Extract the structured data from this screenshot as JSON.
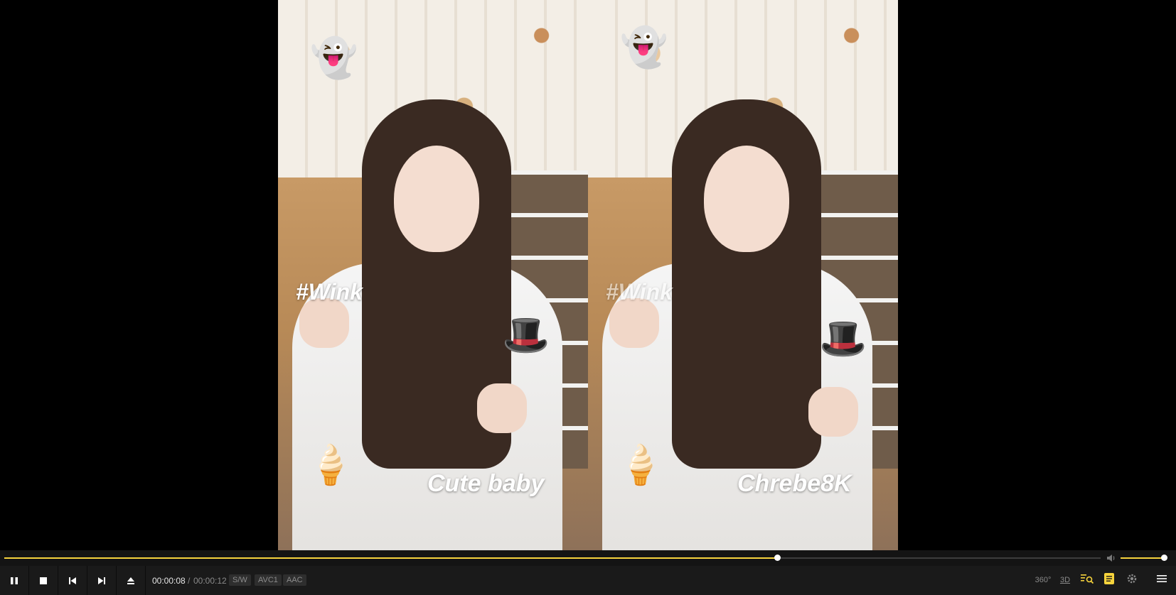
{
  "video": {
    "left_caption_tag": "#Wink",
    "left_caption_main": "Cute baby",
    "right_caption_tag": "#Wink",
    "right_caption_main": "Chrebe8K"
  },
  "playback": {
    "current_time": "00:00:08",
    "separator": "/",
    "total_time": "00:00:12",
    "progress_fraction": 0.705,
    "volume_fraction": 0.95
  },
  "badges": {
    "decoder": "S/W",
    "video_codec": "AVC1",
    "audio_codec": "AAC"
  },
  "right_controls": {
    "vr_label": "360°",
    "three_d_label": "3D"
  },
  "colors": {
    "accent": "#f6d33c",
    "control_bg": "#1a1a1a",
    "seek_bg": "#141414"
  },
  "icons": {
    "play_pause": "pause-icon",
    "stop": "stop-icon",
    "previous": "previous-icon",
    "next": "next-icon",
    "eject": "eject-icon",
    "volume": "volume-icon",
    "vr": "360-icon",
    "three_d": "3d-icon",
    "playlist_search": "playlist-search-icon",
    "subtitles": "subtitle-icon",
    "settings": "gear-icon",
    "menu": "menu-icon"
  }
}
